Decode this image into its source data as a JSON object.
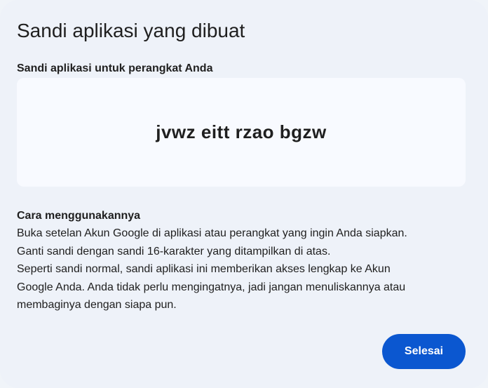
{
  "dialog": {
    "title": "Sandi aplikasi yang dibuat",
    "password_label": "Sandi aplikasi untuk perangkat Anda",
    "password": "jvwz eitt rzao bgzw",
    "howto": {
      "heading": "Cara menggunakannya",
      "lines": [
        "Buka setelan Akun Google di aplikasi atau perangkat yang ingin Anda siapkan.",
        "Ganti sandi dengan sandi 16-karakter yang ditampilkan di atas.",
        "Seperti sandi normal, sandi aplikasi ini memberikan akses lengkap ke Akun",
        "Google Anda. Anda tidak perlu mengingatnya, jadi jangan menuliskannya atau",
        "membaginya dengan siapa pun."
      ]
    },
    "done_label": "Selesai"
  },
  "colors": {
    "background": "#eef2f9",
    "password_box": "#f8faff",
    "primary_button": "#0b57d0",
    "text": "#1f1f1f"
  }
}
